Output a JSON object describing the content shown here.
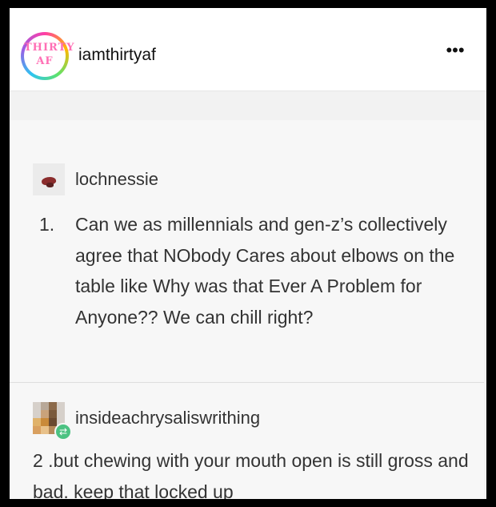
{
  "header": {
    "avatar_text_line1": "THIRTY",
    "avatar_text_line2": "AF",
    "username": "iamthirtyaf",
    "more_icon": "•••"
  },
  "tumblr_post": {
    "original": {
      "blog_name": "lochnessie",
      "list_number": "1.",
      "text": "Can we as millennials and gen-z’s collectively agree that NObody Cares about elbows on the table like Why was that Ever A Problem for Anyone?? We can chill right?"
    },
    "reblog": {
      "blog_name": "insideachrysaliswrithing",
      "reblog_icon": "⇄",
      "text": "2 .but chewing with your mouth open is still gross and bad. keep that locked up"
    }
  }
}
